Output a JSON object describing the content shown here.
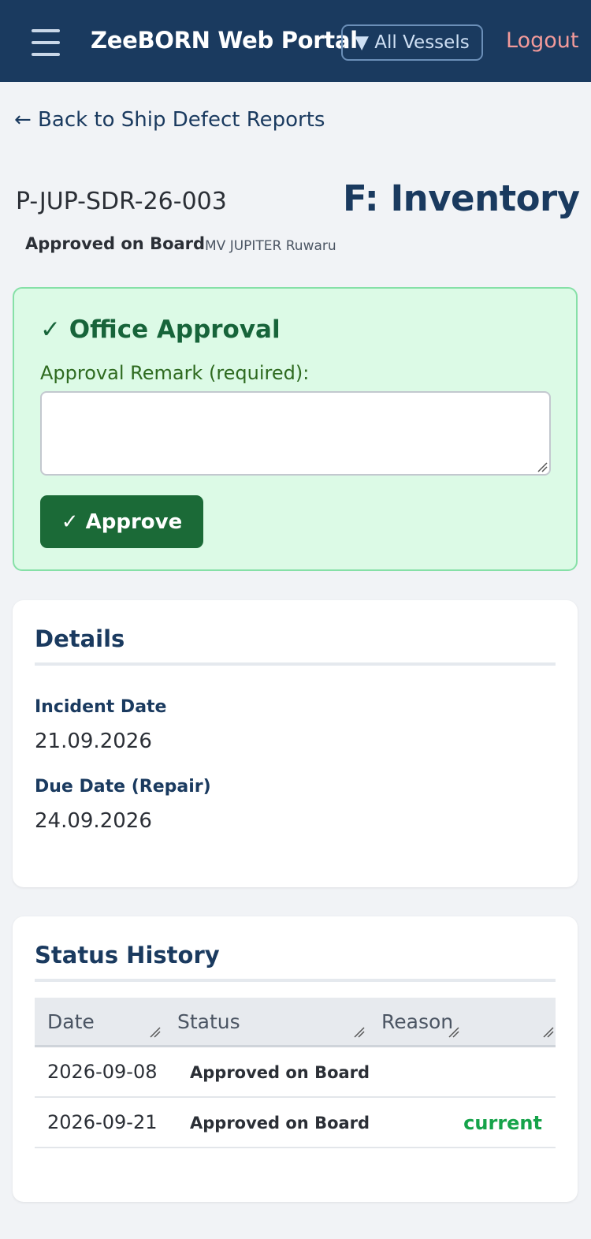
{
  "header": {
    "app_title": "ZeeBORN Web Portal",
    "vessel_filter": "▼ All Vessels",
    "logout_label": "Logout"
  },
  "nav": {
    "back_link": "← Back to Ship Defect Reports"
  },
  "report": {
    "number": "P-JUP-SDR-26-003",
    "title": "F: Inventory",
    "status": "Approved on Board",
    "vessel": "MV JUPITER Ruwaru"
  },
  "approval": {
    "heading": "✓ Office Approval",
    "remark_label": "Approval Remark (required):",
    "remark_value": "",
    "approve_button": "✓ Approve"
  },
  "details": {
    "heading": "Details",
    "fields": [
      {
        "label": "Incident Date",
        "value": "21.09.2026"
      },
      {
        "label": "Due Date (Repair)",
        "value": "24.09.2026"
      }
    ]
  },
  "status_history": {
    "heading": "Status History",
    "columns": [
      "Date",
      "Status",
      "Reason"
    ],
    "rows": [
      {
        "date": "2026-09-08",
        "status": "Approved on Board",
        "reason": ""
      },
      {
        "date": "2026-09-21",
        "status": "Approved on Board",
        "reason": "current"
      }
    ]
  },
  "colors": {
    "header_bg": "#1a3a5f",
    "approve_green": "#1b6a37",
    "approval_box_bg": "#dcfae6",
    "current_green": "#16a34a",
    "logout_pink": "#f29a9a"
  }
}
